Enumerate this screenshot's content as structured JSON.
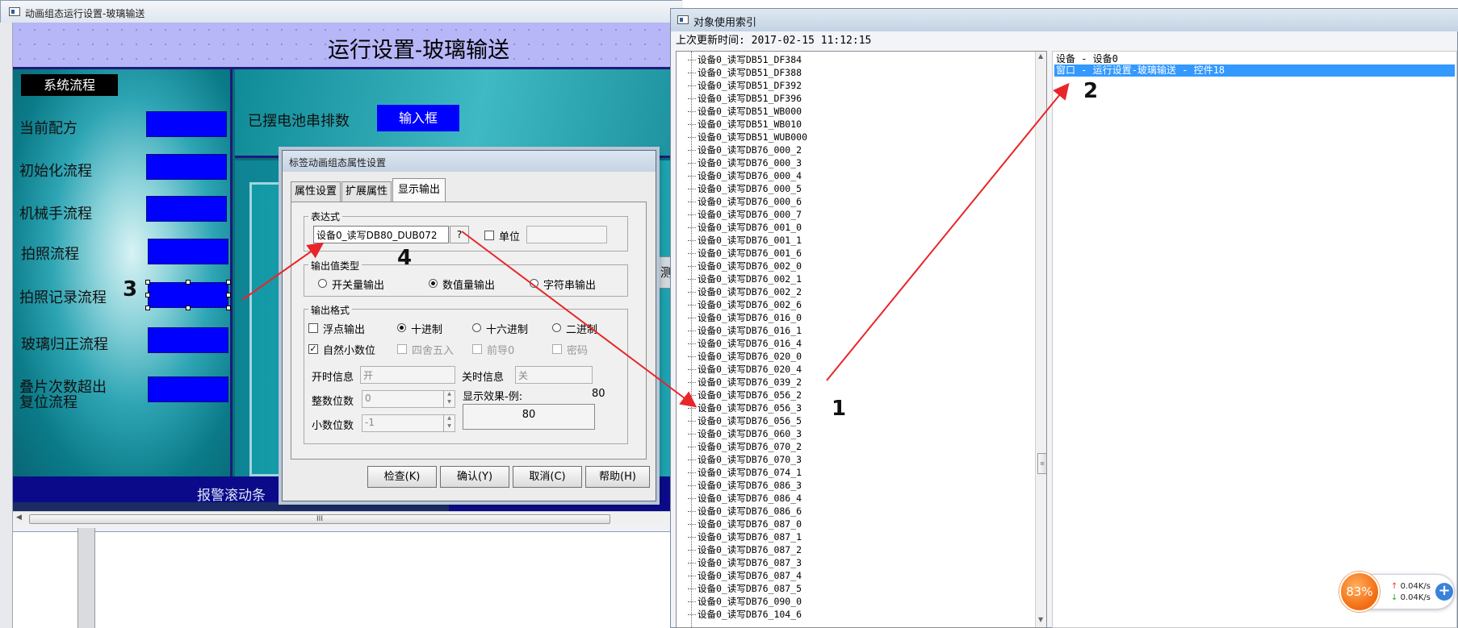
{
  "design_window": {
    "title": "动画组态运行设置-玻璃输送",
    "page_title": "运行设置-玻璃输送",
    "flow_title": "系统流程",
    "rows": [
      {
        "label": "当前配方"
      },
      {
        "label": "初始化流程"
      },
      {
        "label": "机械手流程"
      },
      {
        "label": "拍照流程"
      },
      {
        "label": "拍照记录流程"
      },
      {
        "label": "玻璃归正流程"
      },
      {
        "label": "叠片次数超出"
      },
      {
        "label": "复位流程"
      }
    ],
    "battery_label": "已摆电池串排数",
    "input_box_label": "输入框",
    "alarm_text": "报警滚动条",
    "partial_button_text": "测",
    "scroll_grip": "III"
  },
  "dialog": {
    "title": "标签动画组态属性设置",
    "tabs": [
      {
        "label": "属性设置",
        "active": false
      },
      {
        "label": "扩展属性",
        "active": false
      },
      {
        "label": "显示输出",
        "active": true
      }
    ],
    "expression": {
      "group_title": "表达式",
      "value": "设备0_读写DB80_DUB072",
      "help_button": "?",
      "unit_label": "单位",
      "unit_checked": false
    },
    "output_type": {
      "group_title": "输出值类型",
      "options": [
        {
          "label": "开关量输出",
          "selected": false
        },
        {
          "label": "数值量输出",
          "selected": true
        },
        {
          "label": "字符串输出",
          "selected": false
        }
      ]
    },
    "output_format": {
      "group_title": "输出格式",
      "float_output": {
        "label": "浮点输出",
        "checked": false
      },
      "radix_options": [
        {
          "label": "十进制",
          "selected": true
        },
        {
          "label": "十六进制",
          "selected": false
        },
        {
          "label": "二进制",
          "selected": false
        }
      ],
      "natural_decimal": {
        "label": "自然小数位",
        "checked": true
      },
      "disabled_options": [
        "四舍五入",
        "前导0",
        "密码"
      ],
      "on_info_label": "开时信息",
      "on_info_value": "开",
      "off_info_label": "关时信息",
      "off_info_value": "关",
      "int_digits_label": "整数位数",
      "int_digits_value": "0",
      "effect_label": "显示效果-例:",
      "effect_example": "80",
      "decimal_digits_label": "小数位数",
      "decimal_digits_value": "-1",
      "effect_preview": "80"
    },
    "buttons": {
      "check": "检查(K)",
      "confirm": "确认(Y)",
      "cancel": "取消(C)",
      "help": "帮助(H)"
    }
  },
  "index_window": {
    "title": "对象使用索引",
    "update_label": "上次更新时间:",
    "update_time": "2017-02-15 11:12:15",
    "tree_items": [
      "设备0_读写DB51_DF384",
      "设备0_读写DB51_DF388",
      "设备0_读写DB51_DF392",
      "设备0_读写DB51_DF396",
      "设备0_读写DB51_WB000",
      "设备0_读写DB51_WB010",
      "设备0_读写DB51_WUB000",
      "设备0_读写DB76_000_2",
      "设备0_读写DB76_000_3",
      "设备0_读写DB76_000_4",
      "设备0_读写DB76_000_5",
      "设备0_读写DB76_000_6",
      "设备0_读写DB76_000_7",
      "设备0_读写DB76_001_0",
      "设备0_读写DB76_001_1",
      "设备0_读写DB76_001_6",
      "设备0_读写DB76_002_0",
      "设备0_读写DB76_002_1",
      "设备0_读写DB76_002_2",
      "设备0_读写DB76_002_6",
      "设备0_读写DB76_016_0",
      "设备0_读写DB76_016_1",
      "设备0_读写DB76_016_4",
      "设备0_读写DB76_020_0",
      "设备0_读写DB76_020_4",
      "设备0_读写DB76_039_2",
      "设备0_读写DB76_056_2",
      "设备0_读写DB76_056_3",
      "设备0_读写DB76_056_5",
      "设备0_读写DB76_060_3",
      "设备0_读写DB76_070_2",
      "设备0_读写DB76_070_3",
      "设备0_读写DB76_074_1",
      "设备0_读写DB76_086_3",
      "设备0_读写DB76_086_4",
      "设备0_读写DB76_086_6",
      "设备0_读写DB76_087_0",
      "设备0_读写DB76_087_1",
      "设备0_读写DB76_087_2",
      "设备0_读写DB76_087_3",
      "设备0_读写DB76_087_4",
      "设备0_读写DB76_087_5",
      "设备0_读写DB76_090_0",
      "设备0_读写DB76_104_6"
    ],
    "detail_rows": [
      {
        "text": "设备 - 设备0",
        "selected": false
      },
      {
        "text": "窗口 - 运行设置-玻璃输送 - 控件18",
        "selected": true
      }
    ]
  },
  "callouts": [
    "1",
    "2",
    "3",
    "4"
  ],
  "net_widget": {
    "percent": "83%",
    "up_rate": "0.04K/s",
    "down_rate": "0.04K/s",
    "plus": "+"
  },
  "colors": {
    "canvas_teal": "#0a6b78",
    "header_lavender": "#b7b6f7",
    "blue_box": "#0000ff",
    "selection_blue": "#3399ff",
    "arrow_red": "#e8262a"
  }
}
